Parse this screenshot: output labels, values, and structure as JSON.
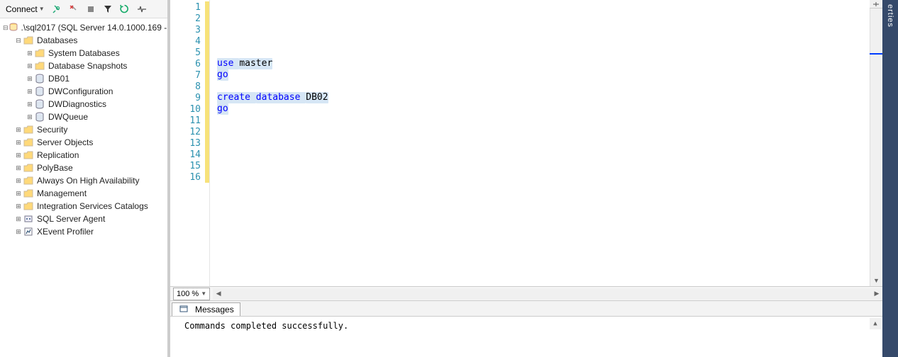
{
  "explorer": {
    "connect_label": "Connect",
    "toolbar_icons": [
      "plug",
      "plug-x",
      "stop",
      "filter",
      "refresh",
      "activity"
    ]
  },
  "tree": [
    {
      "depth": 0,
      "twist": "minus",
      "icon": "server",
      "label": ".\\sql2017 (SQL Server 14.0.1000.169 -"
    },
    {
      "depth": 1,
      "twist": "minus",
      "icon": "folder",
      "label": "Databases"
    },
    {
      "depth": 2,
      "twist": "plus",
      "icon": "folder",
      "label": "System Databases"
    },
    {
      "depth": 2,
      "twist": "plus",
      "icon": "folder",
      "label": "Database Snapshots"
    },
    {
      "depth": 2,
      "twist": "plus",
      "icon": "db",
      "label": "DB01"
    },
    {
      "depth": 2,
      "twist": "plus",
      "icon": "db",
      "label": "DWConfiguration"
    },
    {
      "depth": 2,
      "twist": "plus",
      "icon": "db",
      "label": "DWDiagnostics"
    },
    {
      "depth": 2,
      "twist": "plus",
      "icon": "db",
      "label": "DWQueue"
    },
    {
      "depth": 1,
      "twist": "plus",
      "icon": "folder",
      "label": "Security"
    },
    {
      "depth": 1,
      "twist": "plus",
      "icon": "folder",
      "label": "Server Objects"
    },
    {
      "depth": 1,
      "twist": "plus",
      "icon": "folder",
      "label": "Replication"
    },
    {
      "depth": 1,
      "twist": "plus",
      "icon": "folder",
      "label": "PolyBase"
    },
    {
      "depth": 1,
      "twist": "plus",
      "icon": "folder",
      "label": "Always On High Availability"
    },
    {
      "depth": 1,
      "twist": "plus",
      "icon": "folder",
      "label": "Management"
    },
    {
      "depth": 1,
      "twist": "plus",
      "icon": "folder",
      "label": "Integration Services Catalogs"
    },
    {
      "depth": 1,
      "twist": "plus",
      "icon": "agent",
      "label": "SQL Server Agent"
    },
    {
      "depth": 1,
      "twist": "plus",
      "icon": "profiler",
      "label": "XEvent Profiler"
    }
  ],
  "editor": {
    "line_count": 16,
    "lines": [
      {
        "n": 1,
        "tokens": []
      },
      {
        "n": 2,
        "tokens": []
      },
      {
        "n": 3,
        "tokens": []
      },
      {
        "n": 4,
        "tokens": []
      },
      {
        "n": 5,
        "tokens": []
      },
      {
        "n": 6,
        "tokens": [
          {
            "t": "use ",
            "c": "kw",
            "hl": true
          },
          {
            "t": "master",
            "c": "id",
            "hl": true
          }
        ]
      },
      {
        "n": 7,
        "tokens": [
          {
            "t": "go",
            "c": "kw",
            "hl": true
          }
        ]
      },
      {
        "n": 8,
        "tokens": []
      },
      {
        "n": 9,
        "tokens": [
          {
            "t": "create ",
            "c": "kw",
            "hl": true
          },
          {
            "t": "database ",
            "c": "kw",
            "hl": true
          },
          {
            "t": "DB02",
            "c": "id",
            "hl": true
          }
        ]
      },
      {
        "n": 10,
        "tokens": [
          {
            "t": "go",
            "c": "kw",
            "hl": true
          }
        ]
      },
      {
        "n": 11,
        "tokens": []
      },
      {
        "n": 12,
        "tokens": []
      },
      {
        "n": 13,
        "tokens": []
      },
      {
        "n": 14,
        "tokens": []
      },
      {
        "n": 15,
        "tokens": []
      },
      {
        "n": 16,
        "tokens": []
      }
    ]
  },
  "zoom": {
    "value": "100 %"
  },
  "messages_tab": {
    "label": "Messages"
  },
  "messages": {
    "text": "Commands completed successfully."
  },
  "properties_tab": {
    "label": "erties"
  }
}
